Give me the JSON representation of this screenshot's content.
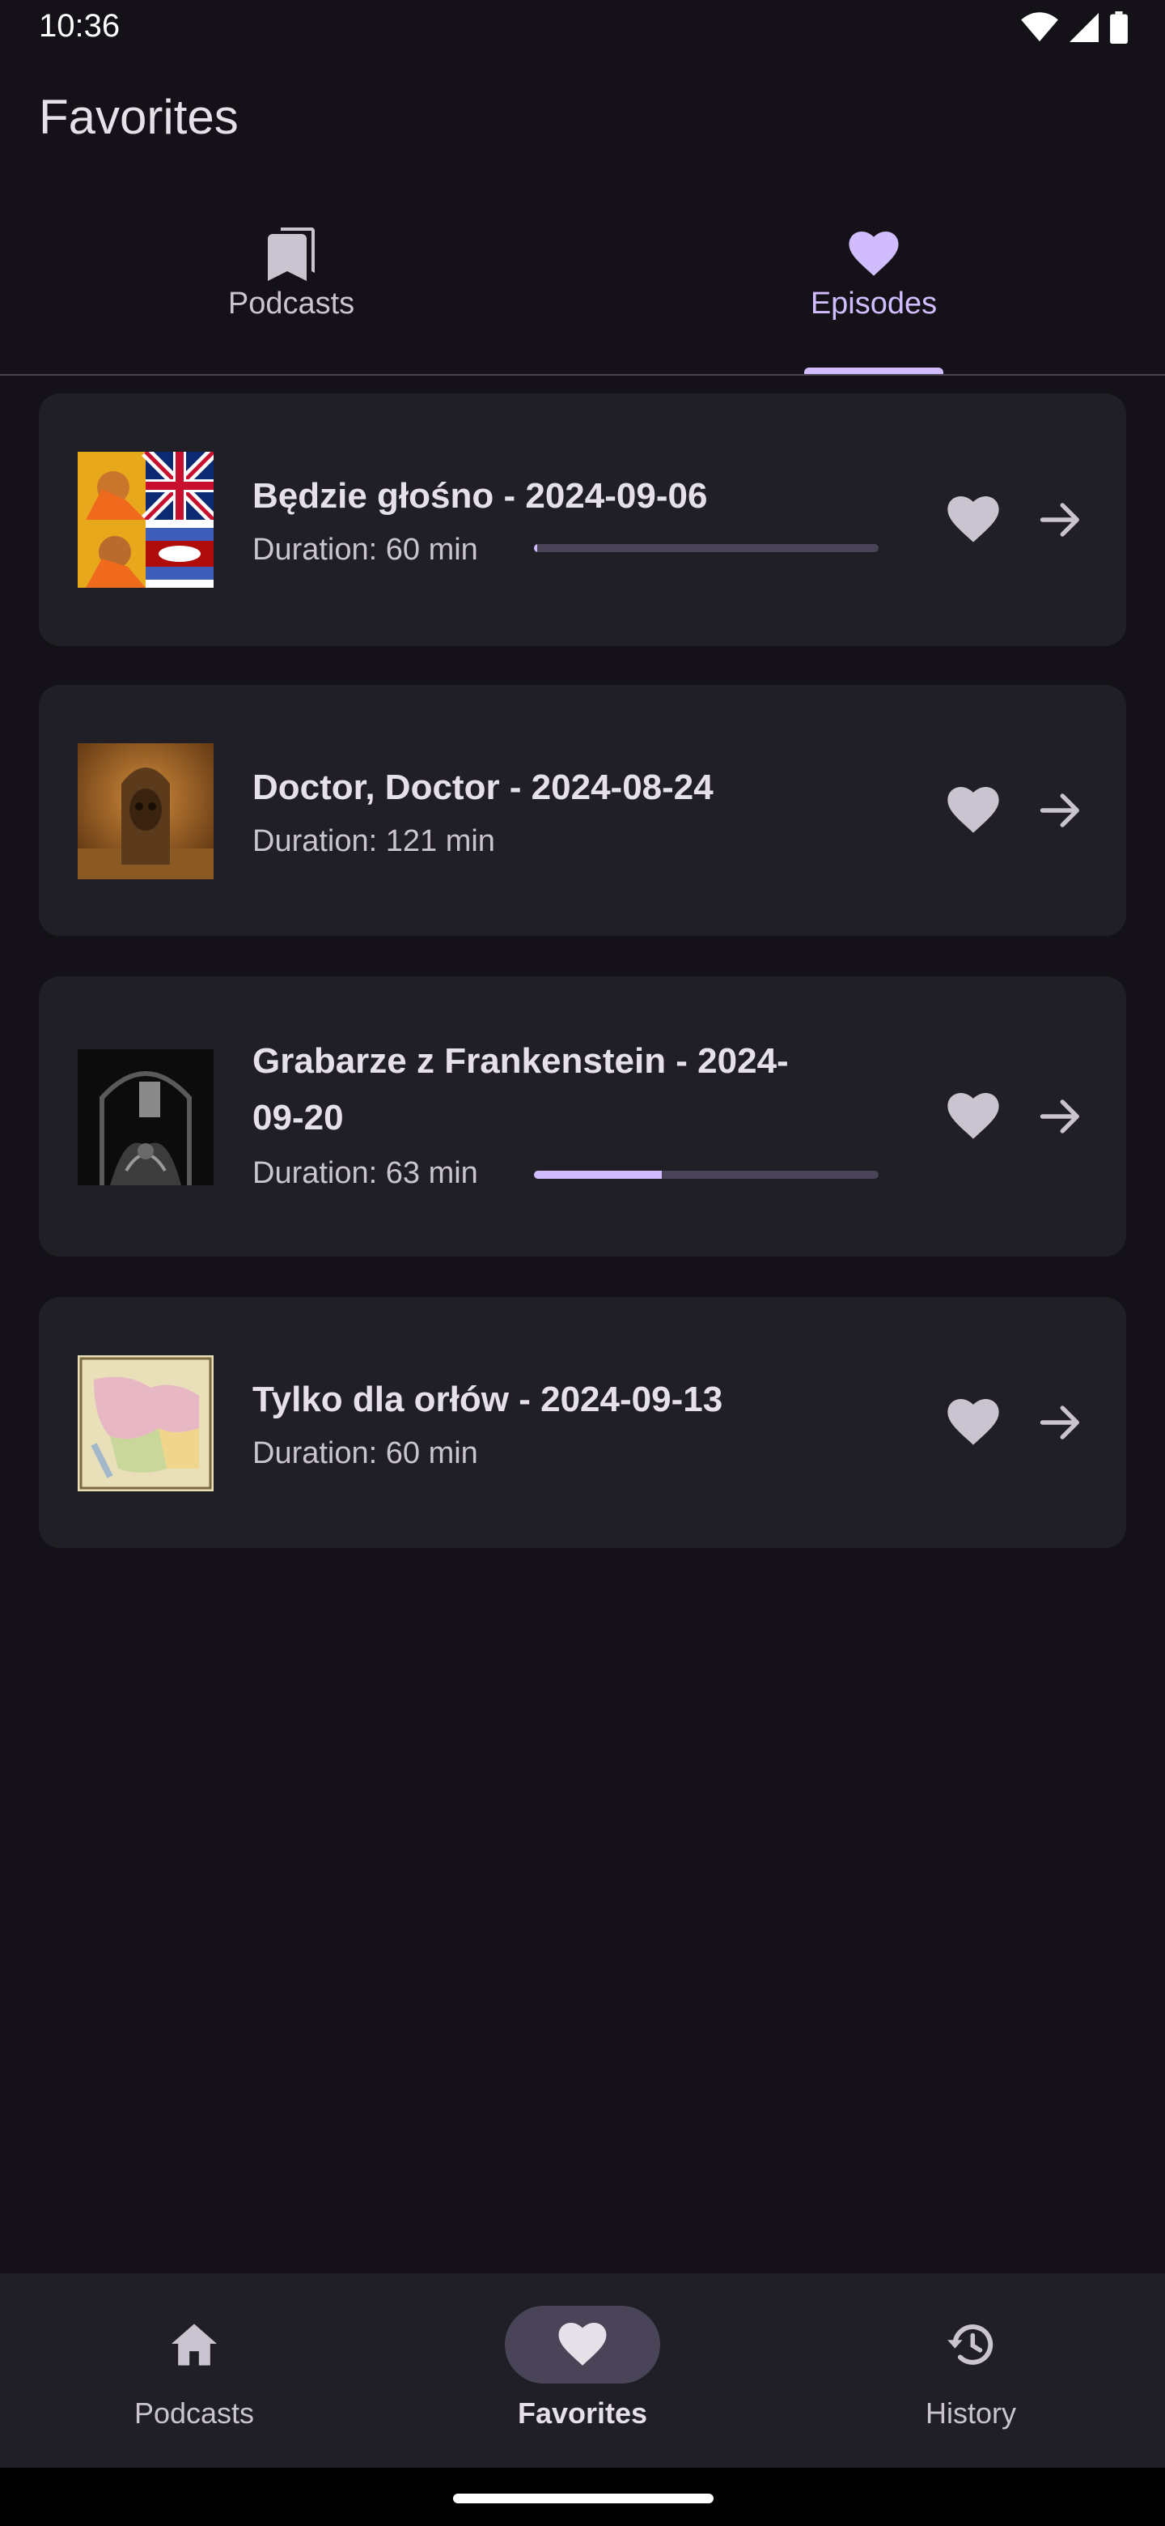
{
  "status_bar": {
    "time": "10:36"
  },
  "app_bar": {
    "title": "Favorites"
  },
  "tabs": [
    {
      "label": "Podcasts",
      "icon": "bookmarks-icon",
      "active": false
    },
    {
      "label": "Episodes",
      "icon": "heart-icon",
      "active": true
    }
  ],
  "episodes": [
    {
      "title": "Będzie głośno - 2024-09-06",
      "duration": "Duration: 60 min",
      "progress": 0.01,
      "favorite": true
    },
    {
      "title": "Doctor, Doctor - 2024-08-24",
      "duration": "Duration: 121 min",
      "progress": null,
      "favorite": true
    },
    {
      "title": "Grabarze z Frankenstein - 2024-09-20",
      "duration": "Duration: 63 min",
      "progress": 0.37,
      "favorite": true
    },
    {
      "title": "Tylko dla orłów - 2024-09-13",
      "duration": "Duration: 60 min",
      "progress": null,
      "favorite": true
    }
  ],
  "bottom_nav": [
    {
      "label": "Podcasts",
      "icon": "home-icon",
      "active": false
    },
    {
      "label": "Favorites",
      "icon": "heart-icon",
      "active": true
    },
    {
      "label": "History",
      "icon": "history-icon",
      "active": false
    }
  ],
  "colors": {
    "background": "#141218",
    "card": "#211f26",
    "accent": "#d0bcff",
    "text": "#e6e0e9",
    "muted": "#cac4d0"
  }
}
